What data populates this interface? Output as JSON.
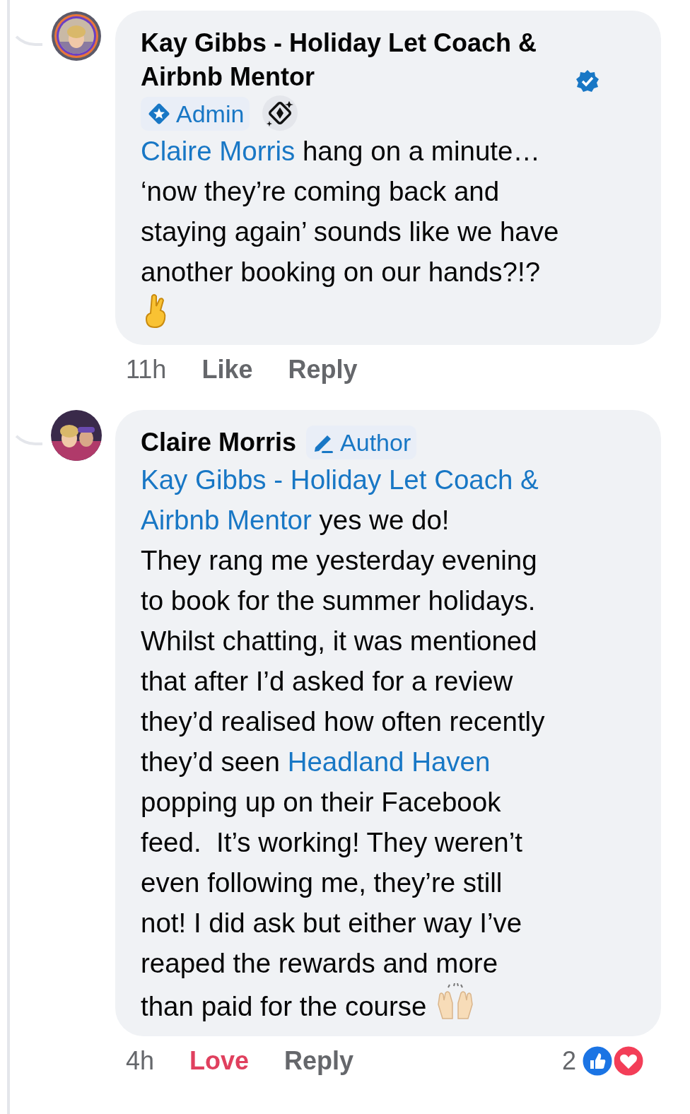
{
  "comments": [
    {
      "author": "Kay Gibbs - Holiday Let Coach & Airbnb Mentor",
      "verified": true,
      "badge": {
        "kind": "admin",
        "label": "Admin"
      },
      "top_fan": true,
      "story_ring": true,
      "lines": [
        [
          {
            "kind": "mention",
            "text": "Claire Morris"
          },
          {
            "kind": "text",
            "text": " hang on a minute…"
          }
        ],
        [
          {
            "kind": "text",
            "text": "‘now they’re coming back and"
          }
        ],
        [
          {
            "kind": "text",
            "text": "staying again’ sounds like we have"
          }
        ],
        [
          {
            "kind": "text",
            "text": "another booking on our hands?!?"
          }
        ],
        [
          {
            "kind": "crossed-fingers"
          }
        ]
      ],
      "time": "11h",
      "reaction_label": "Like",
      "reacted": false,
      "reply_label": "Reply"
    },
    {
      "author": "Claire Morris",
      "verified": false,
      "badge": {
        "kind": "author",
        "label": "Author"
      },
      "top_fan": false,
      "story_ring": false,
      "lines": [
        [
          {
            "kind": "mention",
            "text": "Kay Gibbs - Holiday Let Coach &"
          }
        ],
        [
          {
            "kind": "mention",
            "text": "Airbnb Mentor"
          },
          {
            "kind": "text",
            "text": " yes we do!"
          }
        ],
        [
          {
            "kind": "text",
            "text": "They rang me yesterday evening"
          }
        ],
        [
          {
            "kind": "text",
            "text": "to book for the summer holidays."
          }
        ],
        [
          {
            "kind": "text",
            "text": "Whilst chatting, it was mentioned"
          }
        ],
        [
          {
            "kind": "text",
            "text": "that after I’d asked for a review"
          }
        ],
        [
          {
            "kind": "text",
            "text": "they’d realised how often recently"
          }
        ],
        [
          {
            "kind": "text",
            "text": "they’d seen "
          },
          {
            "kind": "mention",
            "text": "Headland Haven"
          }
        ],
        [
          {
            "kind": "text",
            "text": "popping up on their Facebook"
          }
        ],
        [
          {
            "kind": "text",
            "text": "feed.  It’s working! They weren’t"
          }
        ],
        [
          {
            "kind": "text",
            "text": "even following me, they’re still"
          }
        ],
        [
          {
            "kind": "text",
            "text": "not! I did ask but either way I’ve"
          }
        ],
        [
          {
            "kind": "text",
            "text": "reaped the rewards and more"
          }
        ],
        [
          {
            "kind": "text",
            "text": "than paid for the course "
          },
          {
            "kind": "raising-hands"
          }
        ]
      ],
      "time": "4h",
      "reaction_label": "Love",
      "reacted": true,
      "reply_label": "Reply",
      "reaction_count": "2"
    }
  ]
}
